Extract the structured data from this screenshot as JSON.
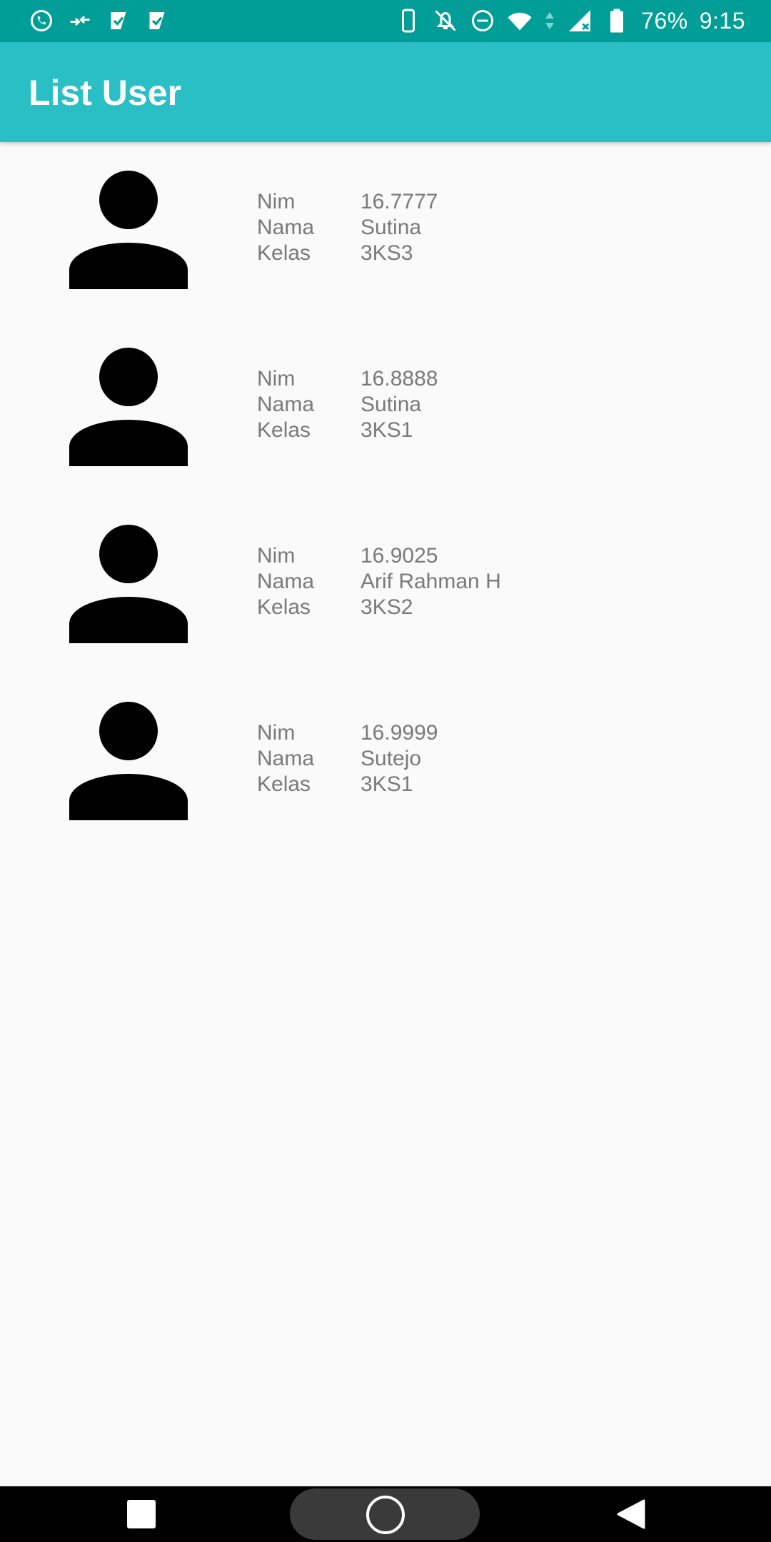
{
  "status_bar": {
    "battery": "76%",
    "time": "9:15",
    "left_icons": [
      "whatsapp-icon",
      "transfer-icon",
      "play-store-icon",
      "play-store-icon"
    ],
    "right_icons": [
      "phone-vibrate-icon",
      "notifications-off-icon",
      "do-not-disturb-icon",
      "wifi-icon",
      "signal-icon",
      "battery-icon"
    ]
  },
  "app_bar": {
    "title": "List User"
  },
  "users": [
    {
      "labels": {
        "nim": "Nim",
        "nama": "Nama",
        "kelas": "Kelas"
      },
      "nim": "16.7777",
      "nama": "Sutina",
      "kelas": "3KS3"
    },
    {
      "labels": {
        "nim": "Nim",
        "nama": "Nama",
        "kelas": "Kelas"
      },
      "nim": "16.8888",
      "nama": "Sutina",
      "kelas": "3KS1"
    },
    {
      "labels": {
        "nim": "Nim",
        "nama": "Nama",
        "kelas": "Kelas"
      },
      "nim": "16.9025",
      "nama": "Arif Rahman H",
      "kelas": "3KS2"
    },
    {
      "labels": {
        "nim": "Nim",
        "nama": "Nama",
        "kelas": "Kelas"
      },
      "nim": "16.9999",
      "nama": "Sutejo",
      "kelas": "3KS1"
    }
  ],
  "nav_bar": {
    "icons": [
      "recents-icon",
      "home-icon",
      "back-icon"
    ]
  },
  "colors": {
    "status_bar": "#009e96",
    "app_bar": "#2abfc5",
    "background": "#fafafa",
    "text": "#7a7a7a"
  }
}
